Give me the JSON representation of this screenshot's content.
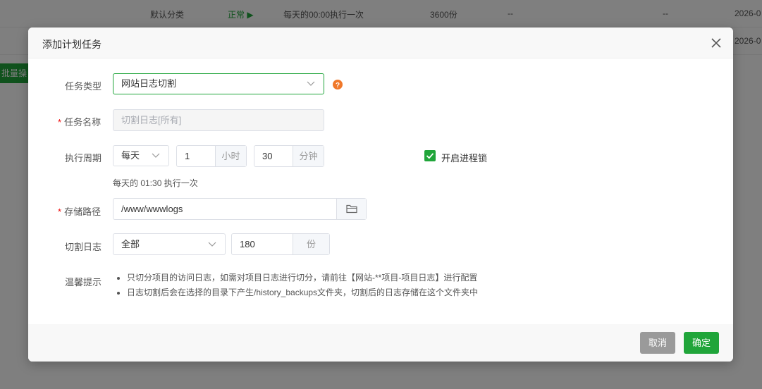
{
  "background": {
    "rows": [
      {
        "category": "默认分类",
        "status": "正常 ▶",
        "cycle": "每天的00:00执行一次",
        "retain": "3600份",
        "col5": "--",
        "col6": "--",
        "date": "2026-0"
      },
      {
        "date": "2026-0"
      }
    ],
    "batch_button": "批量操作"
  },
  "modal": {
    "title": "添加计划任务",
    "fields": {
      "task_type": {
        "label": "任务类型",
        "value": "网站日志切割"
      },
      "task_name": {
        "label": "任务名称",
        "placeholder": "切割日志[所有]"
      },
      "cycle": {
        "label": "执行周期",
        "period": "每天",
        "hours": "1",
        "hours_unit": "小时",
        "minutes": "30",
        "minutes_unit": "分钟",
        "hint": "每天的 01:30 执行一次"
      },
      "process_lock": {
        "label": "开启进程锁",
        "checked": true
      },
      "storage_path": {
        "label": "存储路径",
        "value": "/www/wwwlogs"
      },
      "cut_log": {
        "label": "切割日志",
        "scope": "全部",
        "count": "180",
        "unit": "份"
      }
    },
    "tips": {
      "label": "温馨提示",
      "items": [
        "只切分项目的访问日志，如需对项目日志进行切分，请前往【网站-**项目-项目日志】进行配置",
        "日志切割后会在选择的目录下产生/history_backups文件夹，切割后的日志存储在这个文件夹中"
      ]
    },
    "buttons": {
      "cancel": "取消",
      "confirm": "确定"
    }
  },
  "colors": {
    "accent": "#20a53a",
    "help": "#f0782a",
    "required": "#ef0808"
  }
}
